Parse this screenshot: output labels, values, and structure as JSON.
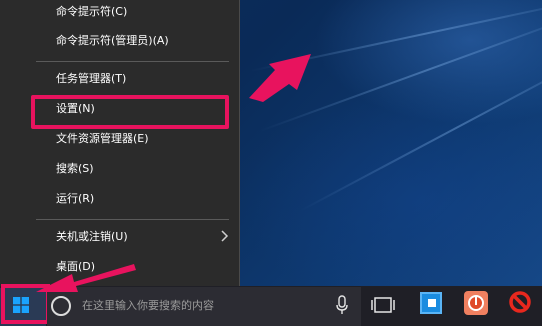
{
  "context_menu": {
    "items": [
      {
        "label": "命令提示符(C)"
      },
      {
        "label": "命令提示符(管理员)(A)"
      },
      {
        "label": "任务管理器(T)"
      },
      {
        "label": "设置(N)"
      },
      {
        "label": "文件资源管理器(E)"
      },
      {
        "label": "搜索(S)"
      },
      {
        "label": "运行(R)"
      },
      {
        "label": "关机或注销(U)"
      },
      {
        "label": "桌面(D)"
      }
    ]
  },
  "taskbar": {
    "search_placeholder": "在这里输入你要搜索的内容"
  },
  "icons": {
    "start": "windows-logo-icon",
    "search": "search-circle-icon",
    "mic": "microphone-icon",
    "task_view": "task-view-icon",
    "app1": "blue-app-icon",
    "app2": "red-power-app-icon",
    "app3": "no-entry-icon",
    "submenu": "chevron-right-icon"
  },
  "colors": {
    "annotation": "#e8135e",
    "menu_bg": "#2b2b2b",
    "taskbar_bg": "#1f1f26"
  }
}
